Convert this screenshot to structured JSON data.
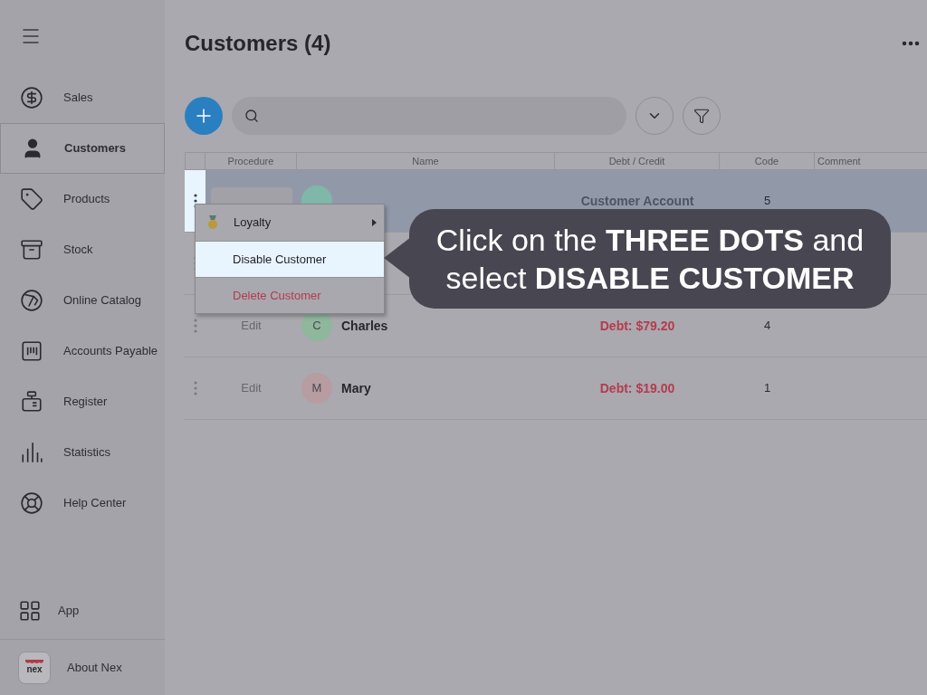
{
  "sidebar": {
    "items": [
      {
        "label": "Sales",
        "selected": false
      },
      {
        "label": "Customers",
        "selected": true
      },
      {
        "label": "Products",
        "selected": false
      },
      {
        "label": "Stock",
        "selected": false
      },
      {
        "label": "Online Catalog",
        "selected": false
      },
      {
        "label": "Accounts Payable",
        "selected": false
      },
      {
        "label": "Register",
        "selected": false
      },
      {
        "label": "Statistics",
        "selected": false
      },
      {
        "label": "Help Center",
        "selected": false
      }
    ],
    "bottom_items": [
      {
        "label": "App"
      },
      {
        "label": "About Nex",
        "logo": "nex"
      }
    ]
  },
  "page": {
    "title": "Customers (4)"
  },
  "table": {
    "columns": [
      "Procedure",
      "Name",
      "Debt / Credit",
      "Code",
      "Comment"
    ],
    "rows": [
      {
        "color": "#7fb8a8",
        "balance": "Customer Account",
        "kind": "account",
        "code": "5",
        "selected": true
      },
      {
        "selected": false
      },
      {
        "procedure": "Edit",
        "avatar": "C",
        "color": "#8fb79c",
        "name": "Charles",
        "balance": "Debt: $79.20",
        "kind": "debt",
        "code": "4",
        "selected": false
      },
      {
        "procedure": "Edit",
        "avatar": "M",
        "color": "#b79ca2",
        "name": "Mary",
        "balance": "Debt: $19.00",
        "kind": "debt",
        "code": "1",
        "selected": false
      }
    ]
  },
  "menu": {
    "items": [
      {
        "label": "Loyalty",
        "kind": "submenu",
        "selected": false
      },
      {
        "label": "Disable Customer",
        "kind": "normal",
        "selected": true
      },
      {
        "label": "Delete Customer",
        "kind": "danger",
        "selected": false
      }
    ]
  },
  "callout": {
    "text": "Click on the **THREE DOTS** and select **DISABLE CUSTOMER**"
  }
}
